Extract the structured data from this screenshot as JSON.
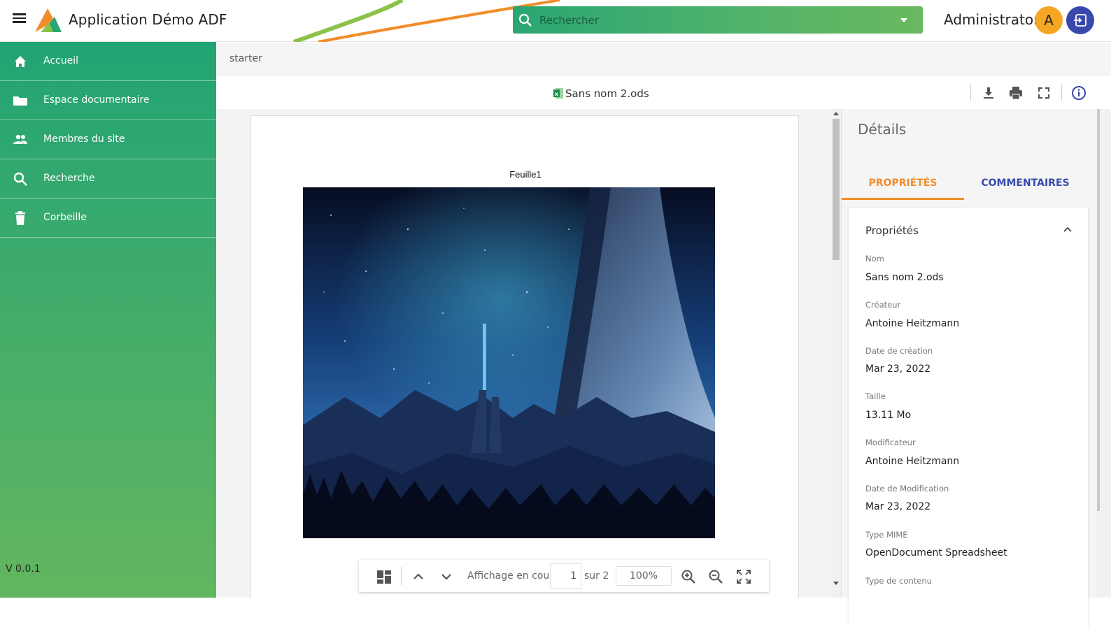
{
  "header": {
    "app_title": "Application Démo ADF",
    "search_placeholder": "Rechercher",
    "username": "Administrator",
    "avatar_initial": "A",
    "accent_green": "#2aa673",
    "accent_orange": "#f28c28",
    "accent_indigo": "#3949ab"
  },
  "sidebar": {
    "items": [
      {
        "label": "Accueil",
        "icon": "home-icon"
      },
      {
        "label": "Espace documentaire",
        "icon": "folder-icon"
      },
      {
        "label": "Membres du site",
        "icon": "people-icon"
      },
      {
        "label": "Recherche",
        "icon": "search-icon"
      },
      {
        "label": "Corbeille",
        "icon": "trash-icon"
      }
    ],
    "version": "V 0.0.1"
  },
  "breadcrumb": {
    "current": "starter"
  },
  "viewer": {
    "file_name": "Sans nom 2.ods",
    "file_icon": "spreadsheet-file-icon",
    "toolbar_icons": [
      "download-icon",
      "print-icon",
      "fullscreen-icon",
      "info-icon"
    ],
    "sheet_title": "Feuille1",
    "image_description_icon": "sheet-image",
    "page_toolbar": {
      "label": "Affichage en cours",
      "current_page": "1",
      "of_label": "sur 2",
      "zoom": "100%"
    }
  },
  "details": {
    "title": "Détails",
    "tabs": [
      "PROPRIÉTÉS",
      "COMMENTAIRES"
    ],
    "active_tab": "PROPRIÉTÉS",
    "section_title": "Propriétés",
    "properties": [
      {
        "label": "Nom",
        "value": "Sans nom 2.ods"
      },
      {
        "label": "Créateur",
        "value": "Antoine Heitzmann"
      },
      {
        "label": "Date de création",
        "value": "Mar 23, 2022"
      },
      {
        "label": "Taille",
        "value": "13.11 Mo"
      },
      {
        "label": "Modificateur",
        "value": "Antoine Heitzmann"
      },
      {
        "label": "Date de Modification",
        "value": "Mar 23, 2022"
      },
      {
        "label": "Type MIME",
        "value": "OpenDocument Spreadsheet"
      },
      {
        "label": "Type de contenu",
        "value": ""
      }
    ]
  }
}
